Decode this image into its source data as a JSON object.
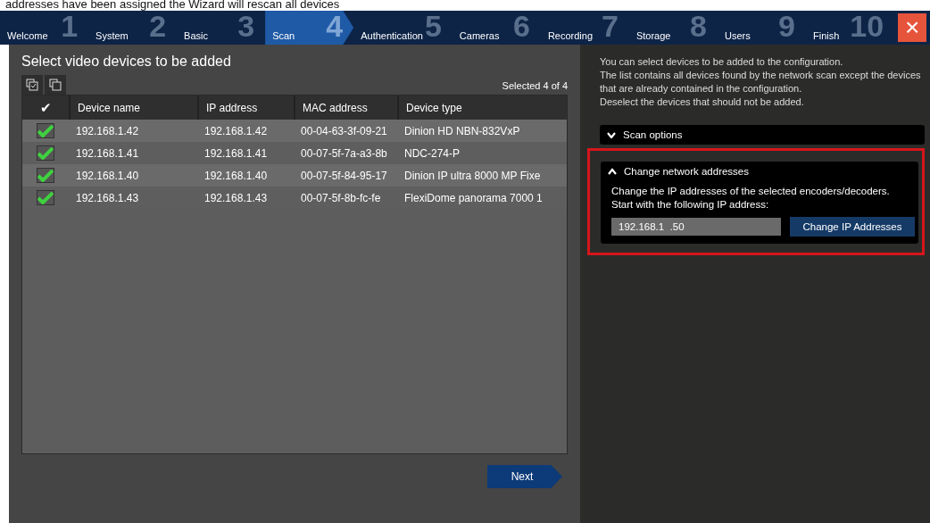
{
  "caption": "addresses have been assigned the Wizard will rescan all devices",
  "steps": [
    {
      "number": "1",
      "label": "Welcome",
      "selected": false
    },
    {
      "number": "2",
      "label": "System",
      "selected": false
    },
    {
      "number": "3",
      "label": "Basic",
      "selected": false
    },
    {
      "number": "4",
      "label": "Scan",
      "selected": true
    },
    {
      "number": "5",
      "label": "Authentication",
      "selected": false
    },
    {
      "number": "6",
      "label": "Cameras",
      "selected": false
    },
    {
      "number": "7",
      "label": "Recording",
      "selected": false
    },
    {
      "number": "8",
      "label": "Storage",
      "selected": false
    },
    {
      "number": "9",
      "label": "Users",
      "selected": false
    },
    {
      "number": "10",
      "label": "Finish",
      "selected": false
    }
  ],
  "close": "×",
  "title": "Select video devices to be added",
  "selected_count": "Selected 4 of 4",
  "table": {
    "check_header": "✔",
    "columns": [
      "Device name",
      "IP address",
      "MAC address",
      "Device type"
    ],
    "rows": [
      {
        "checked": true,
        "cells": [
          "192.168.1.42",
          "192.168.1.42",
          "00-04-63-3f-09-21",
          "Dinion HD NBN-832VxP"
        ]
      },
      {
        "checked": true,
        "cells": [
          "192.168.1.41",
          "192.168.1.41",
          "00-07-5f-7a-a3-8b",
          "NDC-274-P"
        ]
      },
      {
        "checked": true,
        "cells": [
          "192.168.1.40",
          "192.168.1.40",
          "00-07-5f-84-95-17",
          "Dinion IP ultra 8000 MP Fixe"
        ]
      },
      {
        "checked": true,
        "cells": [
          "192.168.1.43",
          "192.168.1.43",
          "00-07-5f-8b-fc-fe",
          "FlexiDome panorama 7000 1"
        ]
      }
    ]
  },
  "next": "Next",
  "help": [
    "You can select devices to be added to the configuration.",
    "The list contains all devices found by the network scan except the devices that are already contained in the configuration.",
    "Deselect the devices that should not be added."
  ],
  "scan_options": {
    "label": "Scan options",
    "expanded": false
  },
  "change_network": {
    "label": "Change network addresses",
    "expanded": true,
    "text": "Change the IP addresses of the selected encoders/decoders. Start with the following IP address:",
    "ip": "192.168.1  .50",
    "button": "Change IP Addresses"
  }
}
